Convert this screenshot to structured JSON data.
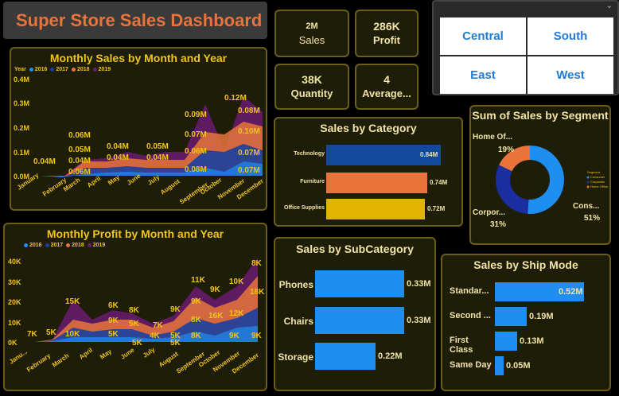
{
  "header": {
    "title": "Super Store Sales Dashboard"
  },
  "kpis": {
    "sales": {
      "value": "2M",
      "label": "Sales"
    },
    "profit": {
      "value": "286K",
      "label": "Profit"
    },
    "quantity": {
      "value": "38K",
      "label": "Quantity"
    },
    "average": {
      "value": "4",
      "label": "Average..."
    }
  },
  "region_slicer": {
    "regions": [
      "Central",
      "South",
      "East",
      "West"
    ]
  },
  "months": [
    "January",
    "February",
    "March",
    "April",
    "May",
    "June",
    "July",
    "August",
    "September",
    "October",
    "November",
    "December"
  ],
  "monthly_sales": {
    "title": "Monthly Sales by Month and Year",
    "legend_title": "Year",
    "years": [
      "2016",
      "2017",
      "2018",
      "2019"
    ],
    "y_ticks": [
      "0.0M",
      "0.1M",
      "0.2M",
      "0.3M",
      "0.4M"
    ],
    "labels": [
      "0.04M",
      "0.06M",
      "0.05M",
      "0.04M",
      "0.06M",
      "0.04M",
      "0.04M",
      "0.05M",
      "0.04M",
      "0.09M",
      "0.07M",
      "0.06M",
      "0.08M",
      "0.12M",
      "0.08M",
      "0.10M",
      "0.07M",
      "0.07M"
    ]
  },
  "monthly_profit": {
    "title": "Monthly Profit by Month and Year",
    "years": [
      "2016",
      "2017",
      "2018",
      "2019"
    ],
    "y_ticks": [
      "0K",
      "10K",
      "20K",
      "30K",
      "40K"
    ],
    "x_labels": [
      "Janu...",
      "February",
      "March",
      "April",
      "May",
      "June",
      "July",
      "August",
      "September",
      "October",
      "November",
      "December"
    ],
    "labels": [
      "7K",
      "5K",
      "15K",
      "10K",
      "6K",
      "9K",
      "5K",
      "8K",
      "5K",
      "7K",
      "4K",
      "9K",
      "5K",
      "11K",
      "9K",
      "8K",
      "9K",
      "8K",
      "10K",
      "16K",
      "12K",
      "9K",
      "8K",
      "18K",
      "9K",
      "5K",
      "5K"
    ]
  },
  "sales_by_category": {
    "title": "Sales by Category",
    "categories": [
      "Technology",
      "Furniture",
      "Office Supplies"
    ],
    "values": [
      "0.84M",
      "0.74M",
      "0.72M"
    ]
  },
  "sales_by_segment": {
    "title": "Sum of Sales by Segment",
    "segments": [
      "Home Of...",
      "Corpor...",
      "Cons..."
    ],
    "percents": [
      "19%",
      "31%",
      "51%"
    ],
    "legend_title": "Segment",
    "legend_items": [
      "Consumer",
      "Corporate",
      "Home Office"
    ]
  },
  "sales_by_subcategory": {
    "title": "Sales by SubCategory",
    "items": [
      "Phones",
      "Chairs",
      "Storage"
    ],
    "values": [
      "0.33M",
      "0.33M",
      "0.22M"
    ]
  },
  "sales_by_shipmode": {
    "title": "Sales by Ship Mode",
    "items": [
      "Standar...",
      "Second ...",
      "First Class",
      "Same Day"
    ],
    "values": [
      "0.52M",
      "0.19M",
      "0.13M",
      "0.05M"
    ]
  },
  "chart_data": [
    {
      "type": "area",
      "title": "Monthly Sales by Month and Year",
      "xlabel": "",
      "ylabel": "",
      "ylim": [
        0,
        0.4
      ],
      "categories": [
        "January",
        "February",
        "March",
        "April",
        "May",
        "June",
        "July",
        "August",
        "September",
        "October",
        "November",
        "December"
      ],
      "series": [
        {
          "name": "2016",
          "values": [
            0.01,
            0.005,
            0.03,
            0.02,
            0.025,
            0.025,
            0.03,
            0.02,
            0.08,
            0.03,
            0.07,
            0.07
          ]
        },
        {
          "name": "2017",
          "values": [
            0.01,
            0.005,
            0.02,
            0.02,
            0.02,
            0.02,
            0.02,
            0.02,
            0.06,
            0.04,
            0.07,
            0.06
          ]
        },
        {
          "name": "2018",
          "values": [
            0.01,
            0.01,
            0.02,
            0.02,
            0.02,
            0.02,
            0.02,
            0.02,
            0.06,
            0.07,
            0.08,
            0.1
          ]
        },
        {
          "name": "2019",
          "values": [
            0.01,
            0.01,
            0.04,
            0.01,
            0.02,
            0.01,
            0.02,
            0.02,
            0.09,
            0.02,
            0.12,
            0.08
          ]
        }
      ]
    },
    {
      "type": "area",
      "title": "Monthly Profit by Month and Year",
      "xlabel": "",
      "ylabel": "",
      "ylim": [
        0,
        40
      ],
      "categories": [
        "January",
        "February",
        "March",
        "April",
        "May",
        "June",
        "July",
        "August",
        "September",
        "October",
        "November",
        "December"
      ],
      "series": [
        {
          "name": "2016",
          "values": [
            3,
            2,
            3,
            3,
            3,
            3,
            3,
            3,
            8,
            5,
            9,
            9
          ]
        },
        {
          "name": "2017",
          "values": [
            2,
            1,
            7,
            3,
            3,
            3,
            1,
            2,
            5,
            5,
            3,
            8
          ]
        },
        {
          "name": "2018",
          "values": [
            2,
            2,
            5,
            3,
            3,
            3,
            2,
            4,
            9,
            9,
            10,
            18
          ]
        },
        {
          "name": "2019",
          "values": [
            1,
            2,
            1,
            2,
            2,
            3,
            1,
            3,
            3,
            1,
            3,
            5
          ]
        }
      ]
    },
    {
      "type": "bar",
      "title": "Sales by Category",
      "categories": [
        "Technology",
        "Furniture",
        "Office Supplies"
      ],
      "values": [
        0.84,
        0.74,
        0.72
      ]
    },
    {
      "type": "pie",
      "title": "Sum of Sales by Segment",
      "categories": [
        "Consumer",
        "Corporate",
        "Home Office"
      ],
      "values": [
        51,
        31,
        19
      ]
    },
    {
      "type": "bar",
      "title": "Sales by SubCategory",
      "categories": [
        "Phones",
        "Chairs",
        "Storage"
      ],
      "values": [
        0.33,
        0.33,
        0.22
      ]
    },
    {
      "type": "bar",
      "title": "Sales by Ship Mode",
      "categories": [
        "Standar...",
        "Second ...",
        "First Class",
        "Same Day"
      ],
      "values": [
        0.52,
        0.19,
        0.13,
        0.05
      ]
    }
  ],
  "colors": {
    "y2016": "#1f8ef1",
    "y2017": "#1a3fa0",
    "y2018": "#e8743b",
    "y2019": "#6a1b6e",
    "accent": "#f0c419",
    "cat_tech": "#12499c",
    "cat_furn": "#e8743b",
    "cat_office": "#e0b400"
  }
}
